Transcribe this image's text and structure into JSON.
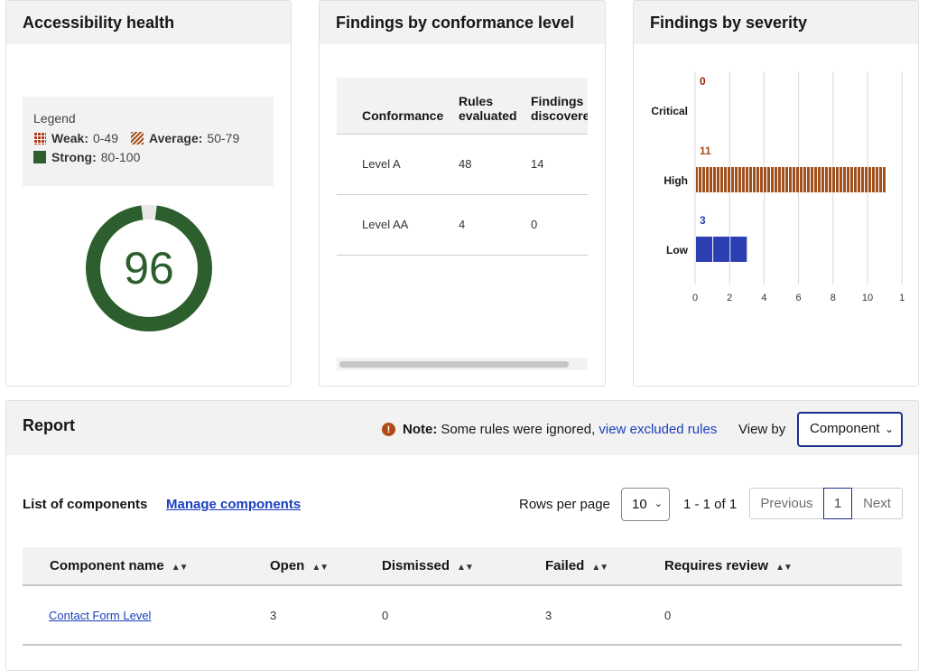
{
  "health": {
    "title": "Accessibility health",
    "legend": {
      "title": "Legend",
      "weak_label": "Weak:",
      "weak_range": "0-49",
      "average_label": "Average:",
      "average_range": "50-79",
      "strong_label": "Strong:",
      "strong_range": "80-100"
    },
    "score": "96",
    "score_value": 96,
    "colors": {
      "strong": "#2d5f2e",
      "weak": "#b03a1e",
      "average": "#a0501d"
    }
  },
  "conformance": {
    "title": "Findings by conformance level",
    "headers": [
      "Conformance",
      "Rules evaluated",
      "Findings discovered"
    ],
    "rows": [
      [
        "Level A",
        "48",
        "14"
      ],
      [
        "Level AA",
        "4",
        "0"
      ]
    ]
  },
  "severity": {
    "title": "Findings by severity",
    "chart_data": {
      "type": "bar",
      "orientation": "horizontal",
      "categories": [
        "Critical",
        "High",
        "Low"
      ],
      "values": [
        0,
        11,
        3
      ],
      "label_colors": [
        "#a31f0f",
        "#a0501d",
        "#2b3fb3"
      ],
      "xlim": [
        0,
        12
      ],
      "x_ticks": [
        "0",
        "2",
        "4",
        "6",
        "8",
        "10",
        "1"
      ],
      "grid": true
    }
  },
  "report": {
    "title": "Report",
    "note_bold": "Note:",
    "note_text": "Some rules were ignored,",
    "note_link": "view excluded rules",
    "view_by_label": "View by",
    "view_by_value": "Component",
    "list_label": "List of components",
    "manage_link": "Manage components",
    "rows_per_page_label": "Rows per page",
    "rows_per_page": "10",
    "range": "1 - 1 of 1",
    "pager": {
      "previous": "Previous",
      "page": "1",
      "next": "Next"
    },
    "columns": [
      "Component name",
      "Open",
      "Dismissed",
      "Failed",
      "Requires review"
    ],
    "rows": [
      {
        "name": "Contact Form Level",
        "open": "3",
        "dismissed": "0",
        "failed": "3",
        "requires_review": "0"
      }
    ]
  }
}
